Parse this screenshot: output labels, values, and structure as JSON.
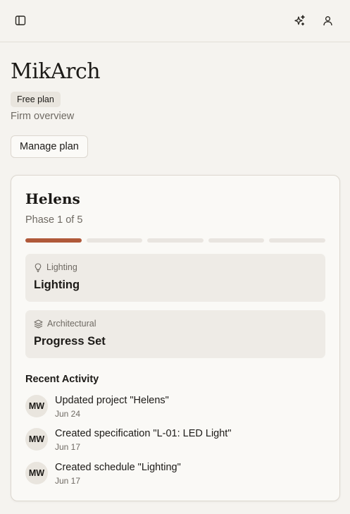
{
  "topbar": {
    "icons": [
      "sidebar-toggle-icon",
      "sparkles-icon",
      "user-icon"
    ]
  },
  "firm": {
    "name": "MikArch",
    "plan_badge": "Free plan",
    "subtitle": "Firm overview",
    "manage_label": "Manage plan"
  },
  "project": {
    "name": "Helens",
    "phase_label": "Phase 1 of 5",
    "phase_current": 1,
    "phase_total": 5,
    "accent_color": "#b0593a",
    "tiles": [
      {
        "kicker": "Lighting",
        "icon": "lightbulb-icon",
        "title": "Lighting"
      },
      {
        "kicker": "Architectural",
        "icon": "layers-icon",
        "title": "Progress Set"
      }
    ]
  },
  "activity": {
    "heading": "Recent Activity",
    "items": [
      {
        "initials": "MW",
        "text": "Updated project \"Helens\"",
        "date": "Jun 24"
      },
      {
        "initials": "MW",
        "text": "Created specification \"L-01: LED Light\"",
        "date": "Jun 17"
      },
      {
        "initials": "MW",
        "text": "Created schedule \"Lighting\"",
        "date": "Jun 17"
      }
    ]
  }
}
